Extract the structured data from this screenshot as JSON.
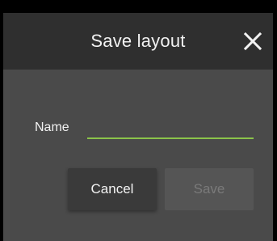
{
  "dialog": {
    "title": "Save layout",
    "close_icon": "close-icon"
  },
  "form": {
    "name_label": "Name",
    "name_value": "",
    "underline_color": "#8bc34a"
  },
  "actions": {
    "cancel_label": "Cancel",
    "save_label": "Save",
    "save_disabled": true
  }
}
